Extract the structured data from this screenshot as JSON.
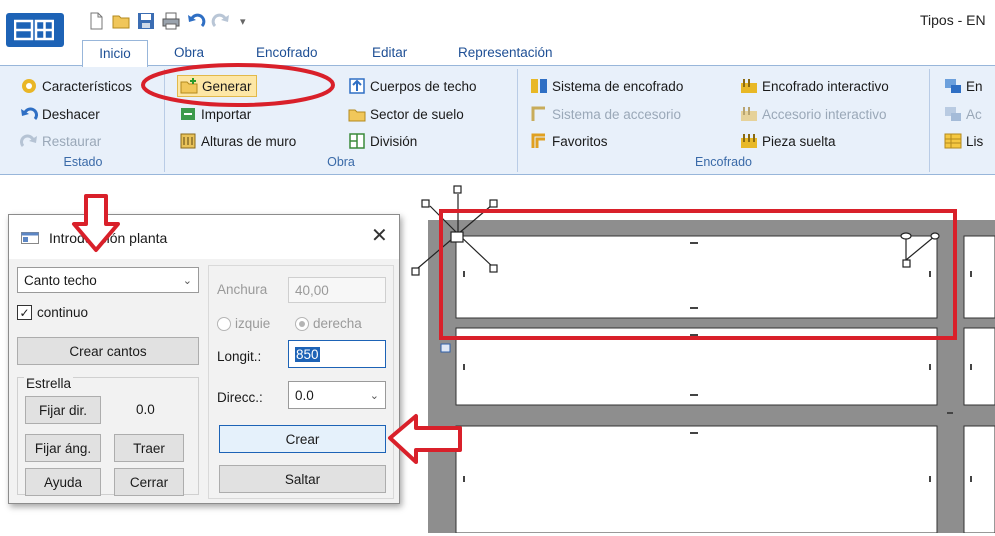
{
  "window": {
    "title": "Tipos - EN"
  },
  "tabs": [
    "Inicio",
    "Obra",
    "Encofrado",
    "Editar",
    "Representación"
  ],
  "ribbon": {
    "estado": {
      "label": "Estado",
      "items": [
        "Característicos",
        "Deshacer",
        "Restaurar"
      ]
    },
    "obra": {
      "label": "Obra",
      "items": [
        "Generar",
        "Importar",
        "Alturas de muro",
        "Cuerpos de techo",
        "Sector de suelo",
        "División"
      ]
    },
    "encofrado": {
      "label": "Encofrado",
      "items": [
        "Sistema de encofrado",
        "Sistema de accesorio",
        "Favoritos",
        "Encofrado interactivo",
        "Accesorio interactivo",
        "Pieza suelta"
      ]
    },
    "extra": {
      "items": [
        "En",
        "Ac",
        "Lis"
      ]
    }
  },
  "dialog": {
    "title": "Introducción planta",
    "type_select": "Canto techo",
    "continuo_label": "continuo",
    "continuo_checked": true,
    "crear_cantos": "Crear cantos",
    "estrella_label": "Estrella",
    "fijar_dir": "Fijar dir.",
    "dir_value": "0.0",
    "fijar_ang": "Fijar áng.",
    "traer": "Traer",
    "ayuda": "Ayuda",
    "cerrar": "Cerrar",
    "anchura_label": "Anchura",
    "anchura_value": "40,00",
    "izquierda": "izquie",
    "derecha": "derecha",
    "longit_label": "Longit.:",
    "longit_value": "850",
    "direcc_label": "Direcc.:",
    "direcc_value": "0.0",
    "crear": "Crear",
    "saltar": "Saltar"
  },
  "colors": {
    "annotation": "#d9202a",
    "accent": "#1d63b6",
    "wall": "#8e8e8e"
  }
}
